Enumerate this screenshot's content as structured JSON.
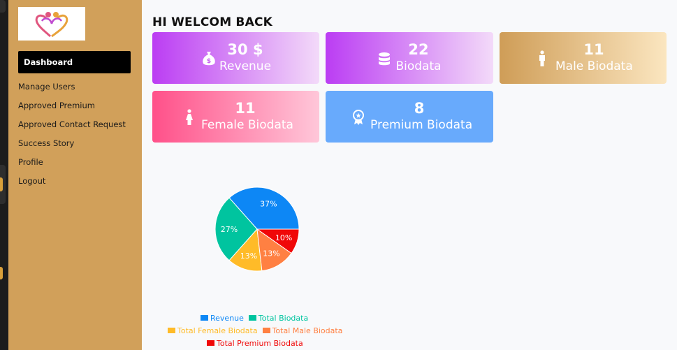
{
  "sidebar": {
    "items": [
      {
        "label": "Dashboard",
        "active": true
      },
      {
        "label": "Manage Users"
      },
      {
        "label": "Approved Premium"
      },
      {
        "label": "Approved Contact Request"
      },
      {
        "label": "Success Story"
      },
      {
        "label": "Profile"
      },
      {
        "label": "Logout"
      }
    ]
  },
  "main": {
    "title": "HI WELCOM BACK",
    "cards": [
      {
        "value": "30 $",
        "label": "Revenue",
        "icon": "money-bag-icon"
      },
      {
        "value": "22",
        "label": "Biodata",
        "icon": "database-icon"
      },
      {
        "value": "11",
        "label": "Male Biodata",
        "icon": "male-icon"
      },
      {
        "value": "11",
        "label": "Female Biodata",
        "icon": "female-icon"
      },
      {
        "value": "8",
        "label": "Premium Biodata",
        "icon": "award-icon"
      }
    ]
  },
  "colors": {
    "sidebar": "#d1a05a",
    "active_nav": "#000000",
    "card_purple": "#bb3df3",
    "card_gold": "#cf9d57",
    "card_pink": "#ff5089",
    "card_blue": "#68aafc"
  },
  "chart_data": {
    "type": "pie",
    "categories": [
      "Revenue",
      "Total Biodata",
      "Total Female Biodata",
      "Total Male Biodata",
      "Total Premium Biodata"
    ],
    "values": [
      30,
      22,
      11,
      11,
      8
    ],
    "percent_labels": [
      "37%",
      "27%",
      "13%",
      "13%",
      "10%"
    ],
    "colors": [
      "#0d87f5",
      "#00c49f",
      "#ffbb28",
      "#ff8042",
      "#f00808"
    ],
    "legend": [
      "Revenue",
      "Total Biodata",
      "Total Female Biodata",
      "Total Male Biodata",
      "Total Premium Biodata"
    ],
    "legend_placement": "bottom"
  }
}
